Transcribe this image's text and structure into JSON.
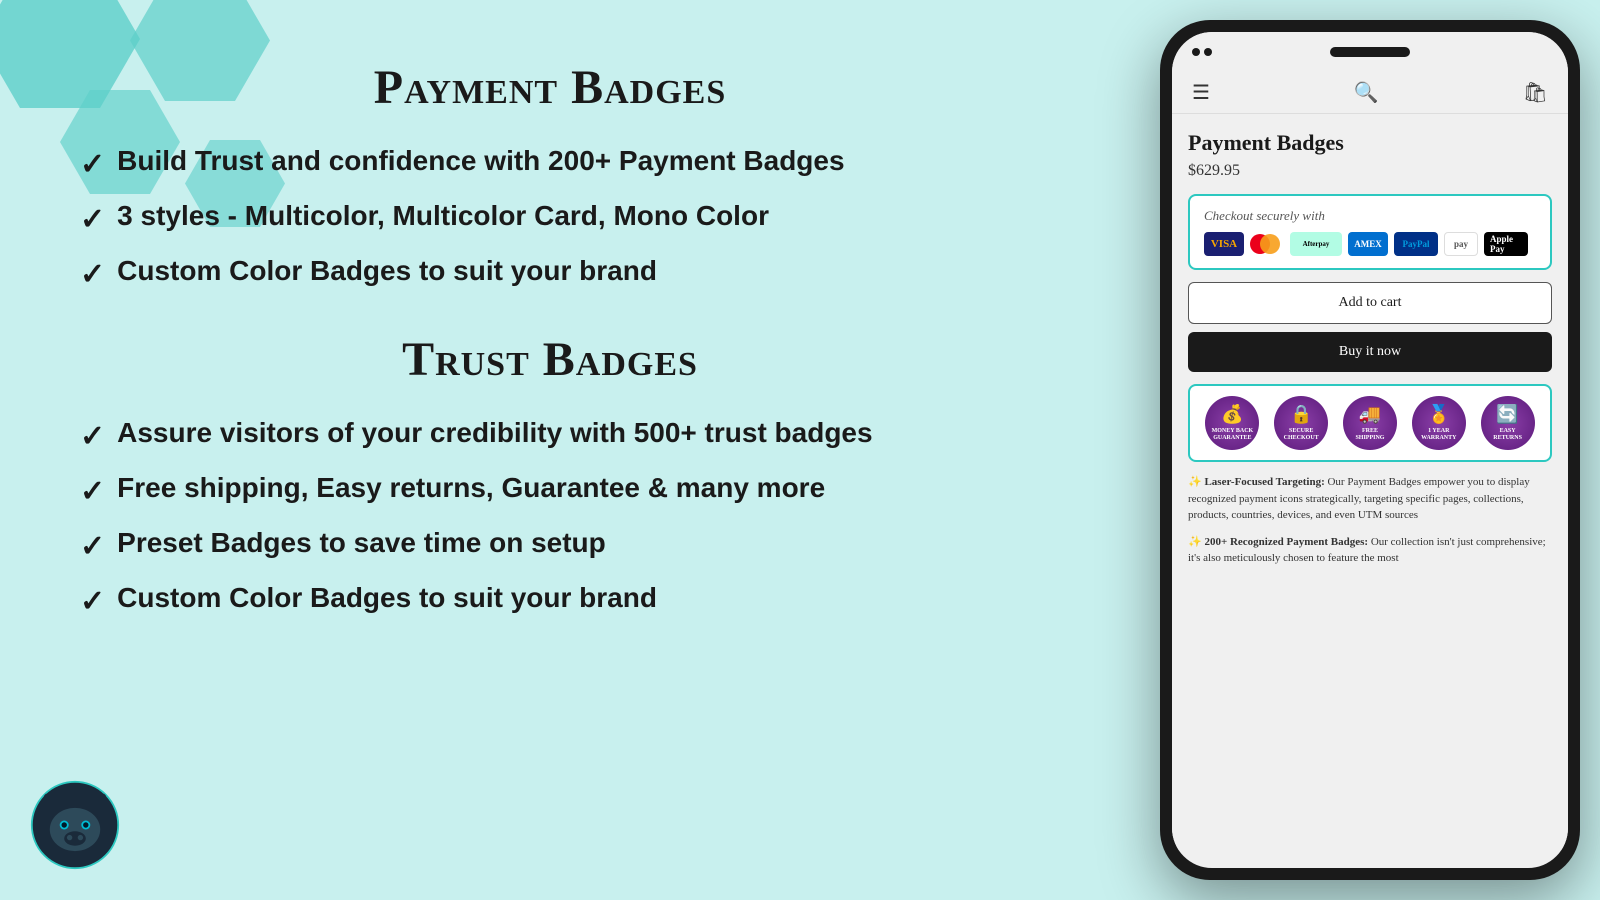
{
  "page": {
    "background_color": "#c8f0ee"
  },
  "left_panel": {
    "payment_section": {
      "title": "Payment Badges",
      "features": [
        "Build Trust and confidence with 200+ Payment Badges",
        "3 styles - Multicolor, Multicolor Card, Mono Color",
        "Custom Color Badges to suit your brand"
      ]
    },
    "trust_section": {
      "title": "Trust Badges",
      "features": [
        "Assure visitors of your credibility with 500+ trust badges",
        "Free shipping, Easy returns, Guarantee & many more",
        "Preset Badges to save time on setup",
        "Custom Color Badges to suit your brand"
      ]
    }
  },
  "phone": {
    "product_title": "Payment Badges",
    "product_price": "$629.95",
    "checkout_label": "Checkout securely with",
    "add_to_cart": "Add to cart",
    "buy_now": "Buy it now",
    "trust_badges": [
      {
        "label": "Money Back\nGuarantee",
        "icon": "💰"
      },
      {
        "label": "Secure\nCheckout",
        "icon": "🔒"
      },
      {
        "label": "Free\nShipping",
        "icon": "🚚"
      },
      {
        "label": "1 Year\nWarranty",
        "icon": "🏅"
      },
      {
        "label": "Easy\nReturns",
        "icon": "🔄"
      }
    ],
    "description_1_title": "Laser-Focused Targeting:",
    "description_1_star": "✨",
    "description_1_text": " Our Payment Badges empower you to display recognized payment icons strategically, targeting specific pages, collections, products, countries, devices, and even UTM sources",
    "description_2_title": "200+ Recognized Payment Badges:",
    "description_2_star": "✨",
    "description_2_text": " Our collection isn't just comprehensive; it's also meticulously chosen to feature the most"
  },
  "nav_icons": {
    "menu": "☰",
    "search": "🔍",
    "cart": "🛍"
  }
}
